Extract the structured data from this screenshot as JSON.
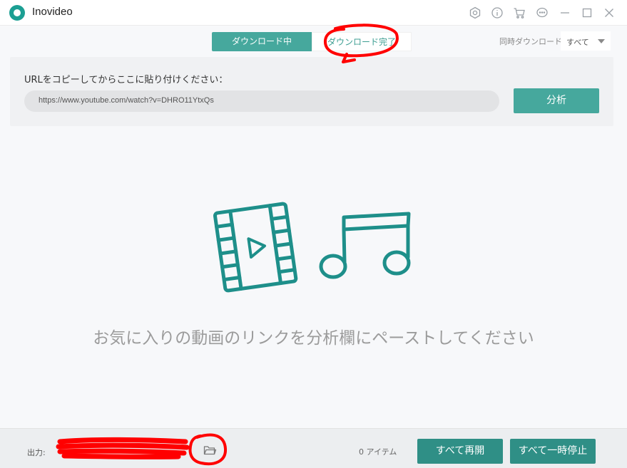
{
  "app": {
    "title": "Inovideo"
  },
  "titlebar_icons": [
    "settings-icon",
    "info-icon",
    "cart-icon",
    "chat-icon",
    "minimize-icon",
    "maximize-icon",
    "close-icon"
  ],
  "tabs": [
    {
      "label": "ダウンロード中",
      "active": true
    },
    {
      "label": "ダウンロード完了",
      "active": false
    }
  ],
  "concurrent": {
    "label": "同時ダウンロード",
    "value": "すべて"
  },
  "url_panel": {
    "label": "URLをコピーしてからここに貼り付けください：",
    "value": "https://www.youtube.com/watch?v=DHRO11YtxQs",
    "analyze_label": "分析"
  },
  "empty_state": {
    "message": "お気に入りの動画のリンクを分析欄にペーストしてください"
  },
  "footer": {
    "output_label": "出力:",
    "item_count": "0 アイテム",
    "resume_all_label": "すべて再開",
    "pause_all_label": "すべて一時停止"
  },
  "colors": {
    "accent": "#46a89d",
    "accent_dark": "#2f8f86",
    "illustration": "#1e8f8a",
    "annotation": "#ff0000"
  }
}
